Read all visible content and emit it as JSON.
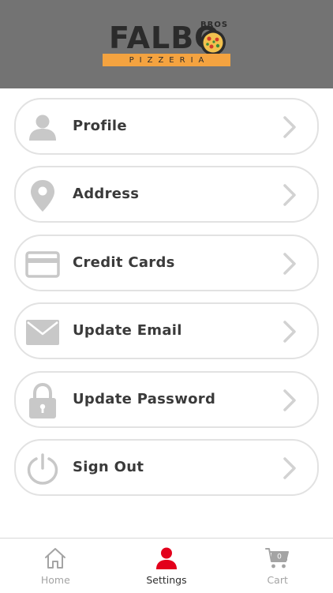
{
  "brand": {
    "name": "FALBO",
    "tagline": "PIZZERIA",
    "sub": "BROS",
    "banner_color": "#f4a340"
  },
  "colors": {
    "header_bg": "#737373",
    "icon_gray": "#c8c8c8",
    "active_red": "#e3001b",
    "inactive_gray": "#a4a4a4"
  },
  "menu": {
    "items": [
      {
        "label": "Profile",
        "icon": "person-icon"
      },
      {
        "label": "Address",
        "icon": "location-pin-icon"
      },
      {
        "label": "Credit Cards",
        "icon": "credit-card-icon"
      },
      {
        "label": "Update Email",
        "icon": "envelope-icon"
      },
      {
        "label": "Update Password",
        "icon": "lock-icon"
      },
      {
        "label": "Sign Out",
        "icon": "power-icon"
      }
    ]
  },
  "tabbar": {
    "tabs": [
      {
        "label": "Home",
        "icon": "home-icon",
        "active": false
      },
      {
        "label": "Settings",
        "icon": "person-icon",
        "active": true
      },
      {
        "label": "Cart",
        "icon": "cart-icon",
        "active": false
      }
    ],
    "cart_count": "0"
  }
}
